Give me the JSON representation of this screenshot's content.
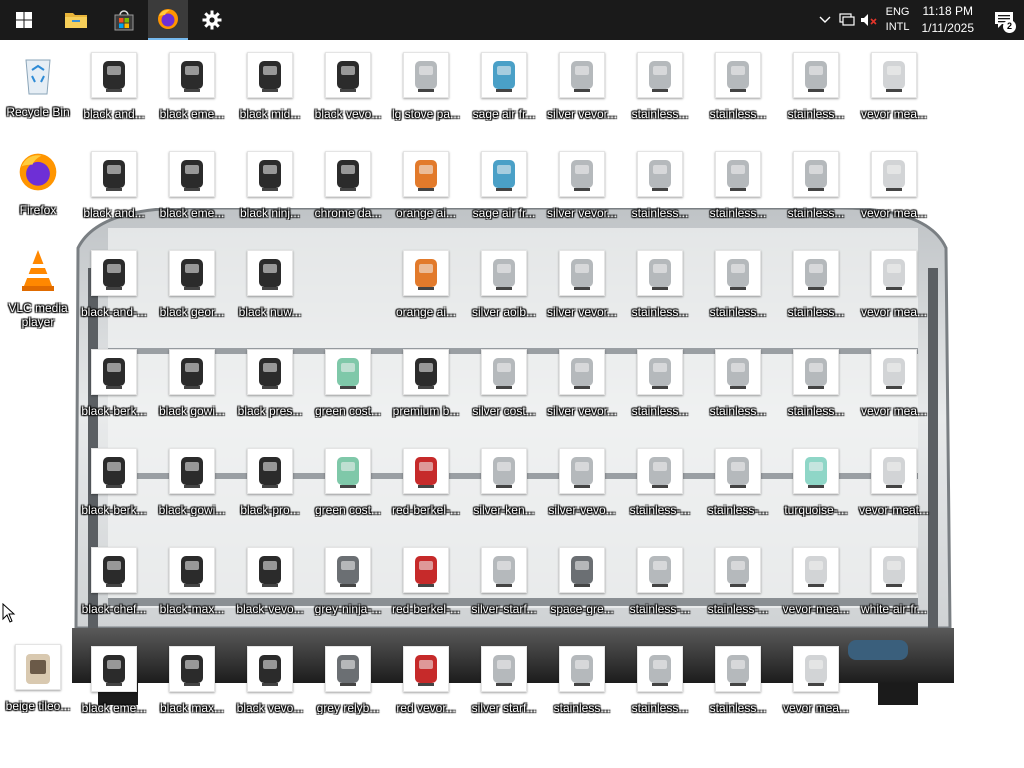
{
  "taskbar": {
    "apps": [
      {
        "name": "start-button",
        "icon": "windows-logo-icon"
      },
      {
        "name": "file-explorer-button",
        "icon": "folder-icon"
      },
      {
        "name": "microsoft-store-button",
        "icon": "store-bag-icon"
      },
      {
        "name": "firefox-taskbar-button",
        "icon": "firefox-icon",
        "active": true
      },
      {
        "name": "settings-button",
        "icon": "gear-icon"
      }
    ],
    "tray": {
      "lang_top": "ENG",
      "lang_bottom": "INTL",
      "time": "11:18 PM",
      "date": "1/11/2025",
      "notification_count": "2"
    }
  },
  "desktop": {
    "system_icons": [
      {
        "label": "Recycle Bin",
        "kind": "recycle"
      },
      {
        "label": "Firefox",
        "kind": "firefox"
      },
      {
        "label": "VLC media player",
        "kind": "vlc"
      }
    ],
    "columns": [
      [
        "black and...",
        "black and...",
        "black-and-...",
        "black-berk...",
        "black-berk...",
        "black-chef...",
        "black eme..."
      ],
      [
        "black eme...",
        "black eme...",
        "black geor...",
        "black gowi...",
        "black-gowi...",
        "black-max...",
        "black max..."
      ],
      [
        "black mid...",
        "black ninj...",
        "black nuw...",
        "black pres...",
        "black-pro...",
        "black-vevo...",
        "black vevo..."
      ],
      [
        "black vevo...",
        "chrome da...",
        "",
        "green cost...",
        "green cost...",
        "grey-ninja-...",
        "grey relyb..."
      ],
      [
        "lg stove pa...",
        "orange ai...",
        "orange ai...",
        "premium b...",
        "red-berkel-...",
        "red-berkel-...",
        "red vevor..."
      ],
      [
        "sage air fr...",
        "sage air fr...",
        "silver aoib...",
        "silver cost...",
        "silver-ken...",
        "silver-starf...",
        "silver starf..."
      ],
      [
        "silver vevor...",
        "silver vevor...",
        "silver vevor...",
        "silver vevor...",
        "silver-vevo...",
        "space-gre...",
        "stainless..."
      ],
      [
        "stainless...",
        "stainless...",
        "stainless...",
        "stainless...",
        "stainless-...",
        "stainless-...",
        "stainless..."
      ],
      [
        "stainless...",
        "stainless...",
        "stainless...",
        "stainless...",
        "stainless-...",
        "stainless-...",
        "stainless..."
      ],
      [
        "stainless...",
        "stainless...",
        "stainless...",
        "stainless...",
        "turquoise-...",
        "vevor-mea...",
        "vevor mea..."
      ],
      [
        "vevor mea...",
        "vevor mea...",
        "vevor mea...",
        "vevor mea...",
        "vevor-meat...",
        "white-air-fr...",
        ""
      ]
    ],
    "beige_icon": {
      "label": "beige tileo..."
    }
  },
  "colors": {
    "taskbar_bg": "#1a1a1a",
    "accent": "#76b9ed"
  }
}
